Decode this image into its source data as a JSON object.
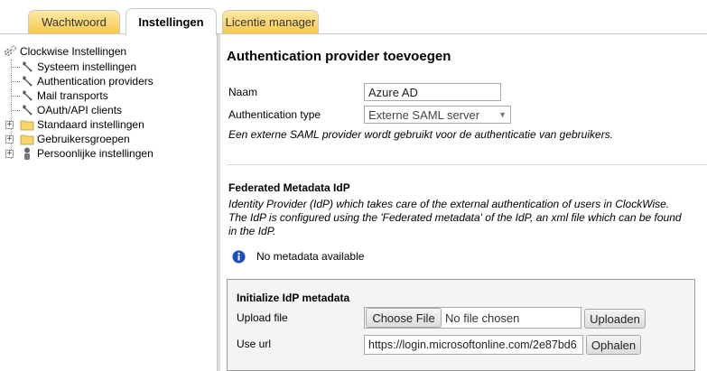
{
  "tabs": [
    {
      "label": "Wachtwoord",
      "active": false
    },
    {
      "label": "Instellingen",
      "active": true
    },
    {
      "label": "Licentie manager",
      "active": false
    }
  ],
  "tree": {
    "root": {
      "label": "Clockwise Instellingen",
      "icon": "gears-icon"
    },
    "children": [
      {
        "label": "Systeem instellingen",
        "icon": "wrench-icon"
      },
      {
        "label": "Authentication providers",
        "icon": "wrench-icon"
      },
      {
        "label": "Mail transports",
        "icon": "wrench-icon"
      },
      {
        "label": "OAuth/API clients",
        "icon": "wrench-icon"
      },
      {
        "label": "Standaard instellingen",
        "icon": "folder-icon",
        "expander": "+"
      },
      {
        "label": "Gebruikersgroepen",
        "icon": "folder-icon",
        "expander": "+"
      },
      {
        "label": "Persoonlijke instellingen",
        "icon": "person-icon",
        "expander": "+"
      }
    ]
  },
  "main": {
    "title": "Authentication provider toevoegen",
    "name_label": "Naam",
    "name_value": "Azure AD",
    "type_label": "Authentication type",
    "type_value": "Externe SAML server",
    "type_help": "Een externe SAML provider wordt gebruikt voor de authenticatie van gebruikers.",
    "section_title": "Federated Metadata IdP",
    "section_desc_1": "Identity Provider (IdP) which takes care of the external authentication of users in ClockWise.",
    "section_desc_2": "The IdP is configured using the 'Federated metadata' of the IdP, an xml file which can be found",
    "section_desc_3": "in the IdP.",
    "info_text": "No metadata available",
    "box": {
      "title": "Initialize IdP metadata",
      "upload_label": "Upload file",
      "choose_file": "Choose File",
      "no_file": "No file chosen",
      "upload_button": "Uploaden",
      "url_label": "Use url",
      "url_value": "https://login.microsoftonline.com/2e87bd6",
      "fetch_button": "Ophalen"
    }
  },
  "colors": {
    "tab_inactive": "#f8c94c",
    "info_icon": "#1a4fc4"
  }
}
